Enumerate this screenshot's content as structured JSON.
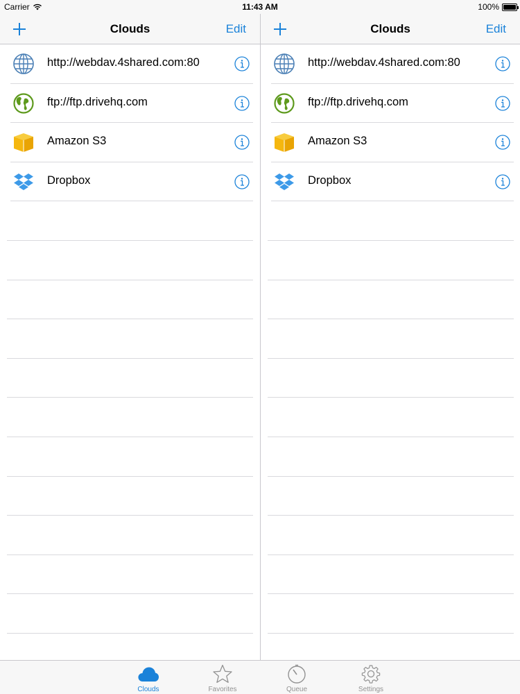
{
  "status_bar": {
    "carrier": "Carrier",
    "time": "11:43 AM",
    "battery": "100%"
  },
  "panes": [
    {
      "nav": {
        "title": "Clouds",
        "edit_label": "Edit",
        "add_icon": "plus-icon"
      },
      "items": [
        {
          "label": "http://webdav.4shared.com:80",
          "icon": "globe-icon"
        },
        {
          "label": "ftp://ftp.drivehq.com",
          "icon": "earth-icon"
        },
        {
          "label": "Amazon S3",
          "icon": "box-icon"
        },
        {
          "label": "Dropbox",
          "icon": "dropbox-icon"
        }
      ]
    },
    {
      "nav": {
        "title": "Clouds",
        "edit_label": "Edit",
        "add_icon": "plus-icon"
      },
      "items": [
        {
          "label": "http://webdav.4shared.com:80",
          "icon": "globe-icon"
        },
        {
          "label": "ftp://ftp.drivehq.com",
          "icon": "earth-icon"
        },
        {
          "label": "Amazon S3",
          "icon": "box-icon"
        },
        {
          "label": "Dropbox",
          "icon": "dropbox-icon"
        }
      ]
    }
  ],
  "tab_bar": {
    "tabs": [
      {
        "label": "Clouds",
        "icon": "cloud-icon",
        "active": true
      },
      {
        "label": "Favorites",
        "icon": "star-icon",
        "active": false
      },
      {
        "label": "Queue",
        "icon": "timer-icon",
        "active": false
      },
      {
        "label": "Settings",
        "icon": "gear-icon",
        "active": false
      }
    ]
  },
  "colors": {
    "accent": "#1a82d9",
    "bar_background": "#f7f7f7",
    "separator": "#c8c7cc",
    "inactive_tab": "#929292",
    "box_yellow": "#f5b70f",
    "earth_green": "#5e9a1d",
    "dropbox_blue": "#3d9ae8"
  }
}
